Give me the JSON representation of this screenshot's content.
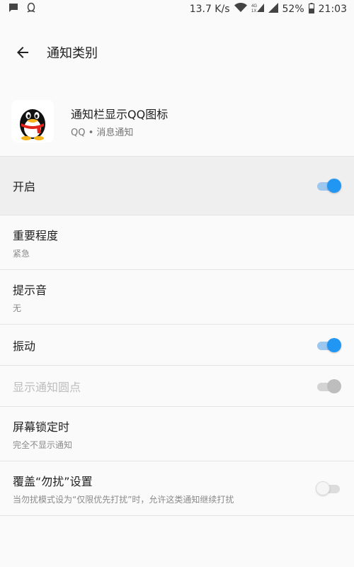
{
  "status_bar": {
    "net_speed": "13.7 K/s",
    "battery": "52%",
    "time": "21:03",
    "icons": [
      "message-icon",
      "qq-notification-icon",
      "wifi-icon",
      "signal-4g-icon",
      "cell-signal-icon",
      "battery-icon"
    ]
  },
  "header": {
    "title": "通知类别"
  },
  "app": {
    "name": "通知栏显示QQ图标",
    "subtitle": "QQ • 消息通知"
  },
  "settings": [
    {
      "title": "开启",
      "state": "on"
    },
    {
      "title": "重要程度",
      "summary": "紧急"
    },
    {
      "title": "提示音",
      "summary": "无"
    },
    {
      "title": "振动",
      "state": "on"
    },
    {
      "title": "显示通知圆点",
      "state": "on",
      "disabled": true
    },
    {
      "title": "屏幕锁定时",
      "summary": "完全不显示通知"
    },
    {
      "title": "覆盖“勿扰”设置",
      "summary": "当勿扰模式设为“仅限优先打扰”时，允许这类通知继续打扰",
      "state": "off"
    }
  ],
  "colors": {
    "accent": "#2196f3",
    "background": "#fafafa"
  }
}
